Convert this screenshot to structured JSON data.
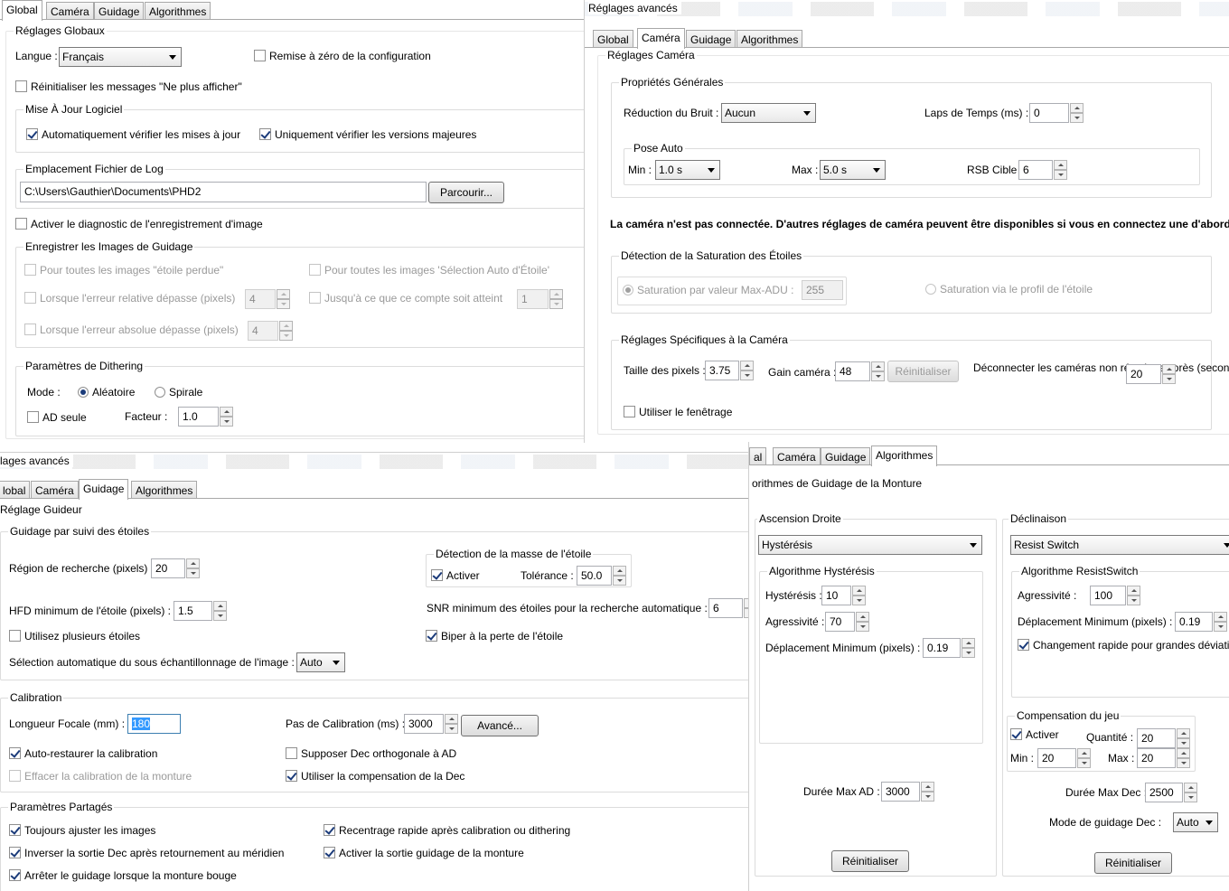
{
  "global": {
    "tabs": [
      "Global",
      "Caméra",
      "Guidage",
      "Algorithmes"
    ],
    "section_title": "Réglages Globaux",
    "language_label": "Langue :",
    "language_value": "Français",
    "reset_config_label": "Remise à zéro de la configuration",
    "reset_messages_label": "Réinitialiser les messages \"Ne plus afficher\"",
    "update_group": "Mise À Jour Logiciel",
    "auto_check_updates": "Automatiquement vérifier les mises à jour",
    "major_only": "Uniquement vérifier les versions majeures",
    "log_group": "Emplacement Fichier de Log",
    "log_path": "C:\\Users\\Gauthier\\Documents\\PHD2",
    "browse_button": "Parcourir...",
    "image_diag_label": "Activer le diagnostic de l'enregistrement d'image",
    "save_images_group": "Enregistrer les Images de Guidage",
    "lost_star_label": "Pour toutes les images \"étoile perdue\"",
    "auto_select_label": "Pour toutes les images 'Sélection Auto d'Étoile'",
    "rel_error_label": "Lorsque l'erreur relative dépasse (pixels)",
    "rel_error_value": "4",
    "until_count_label": "Jusqu'à ce que ce compte soit atteint",
    "until_count_value": "1",
    "abs_error_label": "Lorsque l'erreur absolue dépasse (pixels)",
    "abs_error_value": "4",
    "dither_group": "Paramètres de Dithering",
    "mode_label": "Mode :",
    "random_label": "Aléatoire",
    "spiral_label": "Spirale",
    "ra_only_label": "AD seule",
    "factor_label": "Facteur :",
    "factor_value": "1.0"
  },
  "camera": {
    "window_title": "Réglages avancés",
    "tabs": [
      "Global",
      "Caméra",
      "Guidage",
      "Algorithmes"
    ],
    "section_title": "Réglages Caméra",
    "general_group": "Propriétés Générales",
    "noise_label": "Réduction du Bruit :",
    "noise_value": "Aucun",
    "timelapse_label": "Laps de Temps (ms) :",
    "timelapse_value": "0",
    "auto_exposure_group": "Pose Auto",
    "min_label": "Min :",
    "min_value": "1.0 s",
    "max_label": "Max :",
    "max_value": "5.0 s",
    "snr_label": "RSB Cible :",
    "snr_value": "6",
    "not_connected_msg": "La caméra n'est pas connectée. D'autres réglages de caméra peuvent être disponibles si vous en connectez une d'abord.",
    "saturation_group": "Détection de la Saturation des Étoiles",
    "sat_maxadu_label": "Saturation par valeur Max-ADU :",
    "sat_maxadu_value": "255",
    "sat_profile_label": "Saturation via le profil de l'étoile",
    "specific_group": "Réglages Spécifiques à la Caméra",
    "pixel_size_label": "Taille des pixels :",
    "pixel_size_value": "3.75",
    "gain_label": "Gain caméra :",
    "gain_value": "48",
    "reset_button": "Réinitialiser",
    "disconnect_label": "Déconnecter les caméras non réactives après (secondes) :",
    "disconnect_value": "20",
    "windowing_label": "Utiliser le fenêtrage"
  },
  "guiding": {
    "window_title": "lages avancés",
    "tabs": [
      "lobal",
      "Caméra",
      "Guidage",
      "Algorithmes"
    ],
    "section_title": "Réglage Guideur",
    "star_track_group": "Guidage par suivi des étoiles",
    "search_region_label": "Région de recherche (pixels) :",
    "search_region_value": "20",
    "mass_group": "Détection de la masse de l'étoile",
    "mass_enable_label": "Activer",
    "tolerance_label": "Tolérance :",
    "tolerance_value": "50.0",
    "hfd_label": "HFD minimum de l'étoile (pixels) :",
    "hfd_value": "1.5",
    "snr_min_label": "SNR minimum des étoiles pour la recherche automatique :",
    "snr_min_value": "6",
    "multi_star_label": "Utilisez plusieurs étoiles",
    "beep_label": "Biper à la perte de l'étoile",
    "subsample_label": "Sélection automatique du sous échantillonnage de l'image :",
    "subsample_value": "Auto",
    "calibration_group": "Calibration",
    "focal_label": "Longueur Focale (mm) :",
    "focal_value": "180",
    "cal_step_label": "Pas de Calibration (ms) :",
    "cal_step_value": "3000",
    "advanced_button": "Avancé...",
    "auto_restore_label": "Auto-restaurer la calibration",
    "assume_ortho_label": "Supposer Dec orthogonale à AD",
    "clear_cal_label": "Effacer la calibration de la monture",
    "dec_comp_label": "Utiliser la compensation de la Dec",
    "shared_group": "Paramètres Partagés",
    "always_scale_label": "Toujours ajuster les images",
    "fast_recenter_label": "Recentrage rapide après calibration ou dithering",
    "reverse_dec_label": "Inverser la sortie Dec après retournement au méridien",
    "enable_output_label": "Activer la sortie guidage de la monture",
    "stop_on_slew_label": "Arrêter le guidage lorsque la monture bouge"
  },
  "algorithms": {
    "tabs": [
      "al",
      "Caméra",
      "Guidage",
      "Algorithmes"
    ],
    "section_title": "orithmes de Guidage de la Monture",
    "ra_group": "Ascension Droite",
    "ra_algo_value": "Hystérésis",
    "hyst_group": "Algorithme Hystérésis",
    "hysteresis_label": "Hystérésis :",
    "hysteresis_value": "10",
    "aggr_label": "Agressivité :",
    "aggr_value": "70",
    "min_move_label": "Déplacement Minimum (pixels) :",
    "min_move_value": "0.19",
    "ra_max_label": "Durée Max AD :",
    "ra_max_value": "3000",
    "ra_reset_button": "Réinitialiser",
    "dec_group": "Déclinaison",
    "dec_algo_value": "Resist Switch",
    "rs_group": "Algorithme ResistSwitch",
    "rs_aggr_label": "Agressivité :",
    "rs_aggr_value": "100",
    "rs_min_move_label": "Déplacement Minimum (pixels) :",
    "rs_min_move_value": "0.19",
    "fast_switch_label": "Changement rapide pour grandes déviatio",
    "backlash_group": "Compensation du jeu",
    "backlash_enable_label": "Activer",
    "quantity_label": "Quantité :",
    "quantity_value": "20",
    "bl_min_label": "Min :",
    "bl_min_value": "20",
    "bl_max_label": "Max :",
    "bl_max_value": "20",
    "dec_max_label": "Durée Max Dec :",
    "dec_max_value": "2500",
    "dec_mode_label": "Mode de guidage Dec :",
    "dec_mode_value": "Auto",
    "dec_reset_button": "Réinitialiser"
  }
}
